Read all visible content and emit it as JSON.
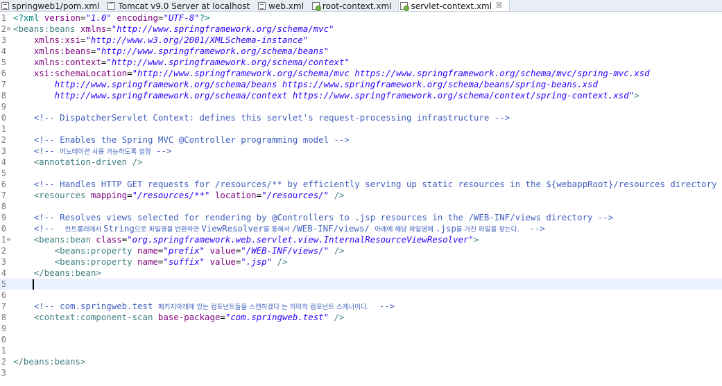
{
  "tabs": [
    {
      "label": "springweb1/pom.xml",
      "icon": "xml-file-icon",
      "active": false
    },
    {
      "label": "Tomcat v9.0 Server at localhost",
      "icon": "server-icon",
      "active": false
    },
    {
      "label": "web.xml",
      "icon": "xml-file-icon",
      "active": false
    },
    {
      "label": "root-context.xml",
      "icon": "spring-bean-file-icon",
      "active": false
    },
    {
      "label": "servlet-context.xml",
      "icon": "spring-bean-file-icon",
      "active": true,
      "close": "☒"
    }
  ],
  "editor": {
    "current_line": 25,
    "lines": [
      {
        "n": "1",
        "segs": [
          {
            "c": "pi",
            "t": "<?xml "
          },
          {
            "c": "attr",
            "t": "version"
          },
          {
            "c": "",
            "t": "="
          },
          {
            "c": "val",
            "t": "\"1.0\""
          },
          {
            "c": "",
            "t": " "
          },
          {
            "c": "attr",
            "t": "encoding"
          },
          {
            "c": "",
            "t": "="
          },
          {
            "c": "val",
            "t": "\"UTF-8\""
          },
          {
            "c": "pi",
            "t": "?>"
          }
        ]
      },
      {
        "n": "2",
        "fold": "⊖",
        "segs": [
          {
            "c": "tag",
            "t": "<beans:beans "
          },
          {
            "c": "attr",
            "t": "xmlns"
          },
          {
            "c": "",
            "t": "="
          },
          {
            "c": "val",
            "t": "\"http://www.springframework.org/schema/mvc\""
          }
        ]
      },
      {
        "n": "3",
        "segs": [
          {
            "c": "",
            "t": "    "
          },
          {
            "c": "attr",
            "t": "xmlns:xsi"
          },
          {
            "c": "",
            "t": "="
          },
          {
            "c": "val",
            "t": "\"http://www.w3.org/2001/XMLSchema-instance\""
          }
        ]
      },
      {
        "n": "4",
        "segs": [
          {
            "c": "",
            "t": "    "
          },
          {
            "c": "attr",
            "t": "xmlns:beans"
          },
          {
            "c": "",
            "t": "="
          },
          {
            "c": "val",
            "t": "\"http://www.springframework.org/schema/beans\""
          }
        ]
      },
      {
        "n": "5",
        "segs": [
          {
            "c": "",
            "t": "    "
          },
          {
            "c": "attr",
            "t": "xmlns:context"
          },
          {
            "c": "",
            "t": "="
          },
          {
            "c": "val",
            "t": "\"http://www.springframework.org/schema/context\""
          }
        ]
      },
      {
        "n": "6",
        "segs": [
          {
            "c": "",
            "t": "    "
          },
          {
            "c": "attr",
            "t": "xsi:schemaLocation"
          },
          {
            "c": "",
            "t": "="
          },
          {
            "c": "val",
            "t": "\"http://www.springframework.org/schema/mvc https://www.springframework.org/schema/mvc/spring-mvc.xsd"
          }
        ]
      },
      {
        "n": "7",
        "segs": [
          {
            "c": "val",
            "t": "        http://www.springframework.org/schema/beans https://www.springframework.org/schema/beans/spring-beans.xsd"
          }
        ]
      },
      {
        "n": "8",
        "segs": [
          {
            "c": "val",
            "t": "        http://www.springframework.org/schema/context https://www.springframework.org/schema/context/spring-context.xsd\""
          },
          {
            "c": "tag",
            "t": ">"
          }
        ]
      },
      {
        "n": "9",
        "segs": []
      },
      {
        "n": "0",
        "segs": [
          {
            "c": "",
            "t": "    "
          },
          {
            "c": "com",
            "t": "<!-- DispatcherServlet Context: defines this servlet's request-processing infrastructure -->"
          }
        ]
      },
      {
        "n": "1",
        "segs": []
      },
      {
        "n": "2",
        "segs": [
          {
            "c": "",
            "t": "    "
          },
          {
            "c": "com",
            "t": "<!-- Enables the Spring MVC @Controller programming model -->"
          }
        ]
      },
      {
        "n": "3",
        "segs": [
          {
            "c": "",
            "t": "    "
          },
          {
            "c": "com",
            "t": "<!-- "
          },
          {
            "c": "ko",
            "t": "어노테이션 사용 가능하도록 설정"
          },
          {
            "c": "com",
            "t": " -->"
          }
        ]
      },
      {
        "n": "4",
        "segs": [
          {
            "c": "",
            "t": "    "
          },
          {
            "c": "tag",
            "t": "<annotation-driven />"
          }
        ]
      },
      {
        "n": "5",
        "segs": []
      },
      {
        "n": "6",
        "segs": [
          {
            "c": "",
            "t": "    "
          },
          {
            "c": "com",
            "t": "<!-- Handles HTTP GET requests for /resources/** by efficiently serving up static resources in the ${webappRoot}/resources directory -->"
          }
        ]
      },
      {
        "n": "7",
        "segs": [
          {
            "c": "",
            "t": "    "
          },
          {
            "c": "tag",
            "t": "<resources "
          },
          {
            "c": "attr",
            "t": "mapping"
          },
          {
            "c": "",
            "t": "="
          },
          {
            "c": "val",
            "t": "\"/resources/**\""
          },
          {
            "c": "",
            "t": " "
          },
          {
            "c": "attr",
            "t": "location"
          },
          {
            "c": "",
            "t": "="
          },
          {
            "c": "val",
            "t": "\"/resources/\""
          },
          {
            "c": "tag",
            "t": " />"
          }
        ]
      },
      {
        "n": "8",
        "segs": []
      },
      {
        "n": "9",
        "segs": [
          {
            "c": "",
            "t": "    "
          },
          {
            "c": "com",
            "t": "<!-- Resolves views selected for rendering by @Controllers to .jsp resources in the /WEB-INF/views directory -->"
          }
        ]
      },
      {
        "n": "0",
        "segs": [
          {
            "c": "",
            "t": "    "
          },
          {
            "c": "com",
            "t": "<!--  "
          },
          {
            "c": "ko",
            "t": "컨트롤러에서 "
          },
          {
            "c": "com",
            "t": "String"
          },
          {
            "c": "ko",
            "t": "으로 파일명을 반환하면 "
          },
          {
            "c": "com",
            "t": "ViewResolver"
          },
          {
            "c": "ko",
            "t": "를 통해서 "
          },
          {
            "c": "com",
            "t": "/WEB-INF/views/ "
          },
          {
            "c": "ko",
            "t": "아래에 해당 파일명에 "
          },
          {
            "c": "com",
            "t": ".jsp"
          },
          {
            "c": "ko",
            "t": "를 가진 파일을 찾는다."
          },
          {
            "c": "com",
            "t": "  -->"
          }
        ]
      },
      {
        "n": "1",
        "fold": "⊖",
        "segs": [
          {
            "c": "",
            "t": "    "
          },
          {
            "c": "tag",
            "t": "<beans:bean "
          },
          {
            "c": "attr",
            "t": "class"
          },
          {
            "c": "",
            "t": "="
          },
          {
            "c": "val",
            "t": "\"org.springframework.web.servlet.view.InternalResourceViewResolver\""
          },
          {
            "c": "tag",
            "t": ">"
          }
        ]
      },
      {
        "n": "2",
        "segs": [
          {
            "c": "",
            "t": "        "
          },
          {
            "c": "tag",
            "t": "<beans:property "
          },
          {
            "c": "attr",
            "t": "name"
          },
          {
            "c": "",
            "t": "="
          },
          {
            "c": "val",
            "t": "\"prefix\""
          },
          {
            "c": "",
            "t": " "
          },
          {
            "c": "attr",
            "t": "value"
          },
          {
            "c": "",
            "t": "="
          },
          {
            "c": "val",
            "t": "\"/WEB-INF/views/\""
          },
          {
            "c": "tag",
            "t": " />"
          }
        ]
      },
      {
        "n": "3",
        "segs": [
          {
            "c": "",
            "t": "        "
          },
          {
            "c": "tag",
            "t": "<beans:property "
          },
          {
            "c": "attr",
            "t": "name"
          },
          {
            "c": "",
            "t": "="
          },
          {
            "c": "val",
            "t": "\"suffix\""
          },
          {
            "c": "",
            "t": " "
          },
          {
            "c": "attr",
            "t": "value"
          },
          {
            "c": "",
            "t": "="
          },
          {
            "c": "val",
            "t": "\".jsp\""
          },
          {
            "c": "tag",
            "t": " />"
          }
        ]
      },
      {
        "n": "4",
        "segs": [
          {
            "c": "",
            "t": "    "
          },
          {
            "c": "tag",
            "t": "</beans:bean>"
          }
        ]
      },
      {
        "n": "5",
        "segs": []
      },
      {
        "n": "6",
        "segs": []
      },
      {
        "n": "7",
        "segs": [
          {
            "c": "",
            "t": "    "
          },
          {
            "c": "com",
            "t": "<!-- com.springweb.test "
          },
          {
            "c": "ko",
            "t": "패키지아래에 있는 컴포넌트들을 스캔하겠다 는 의미의 컴포넌트 스캐너이다."
          },
          {
            "c": "com",
            "t": "  -->"
          }
        ]
      },
      {
        "n": "8",
        "segs": [
          {
            "c": "",
            "t": "    "
          },
          {
            "c": "tag",
            "t": "<context:component-scan "
          },
          {
            "c": "attr",
            "t": "base-package"
          },
          {
            "c": "",
            "t": "="
          },
          {
            "c": "val",
            "t": "\"com.springweb.test\""
          },
          {
            "c": "tag",
            "t": " />"
          }
        ]
      },
      {
        "n": "9",
        "segs": []
      },
      {
        "n": "0",
        "segs": []
      },
      {
        "n": "1",
        "segs": []
      },
      {
        "n": "2",
        "segs": [
          {
            "c": "tag",
            "t": "</beans:beans>"
          }
        ]
      },
      {
        "n": "3",
        "segs": []
      }
    ]
  }
}
